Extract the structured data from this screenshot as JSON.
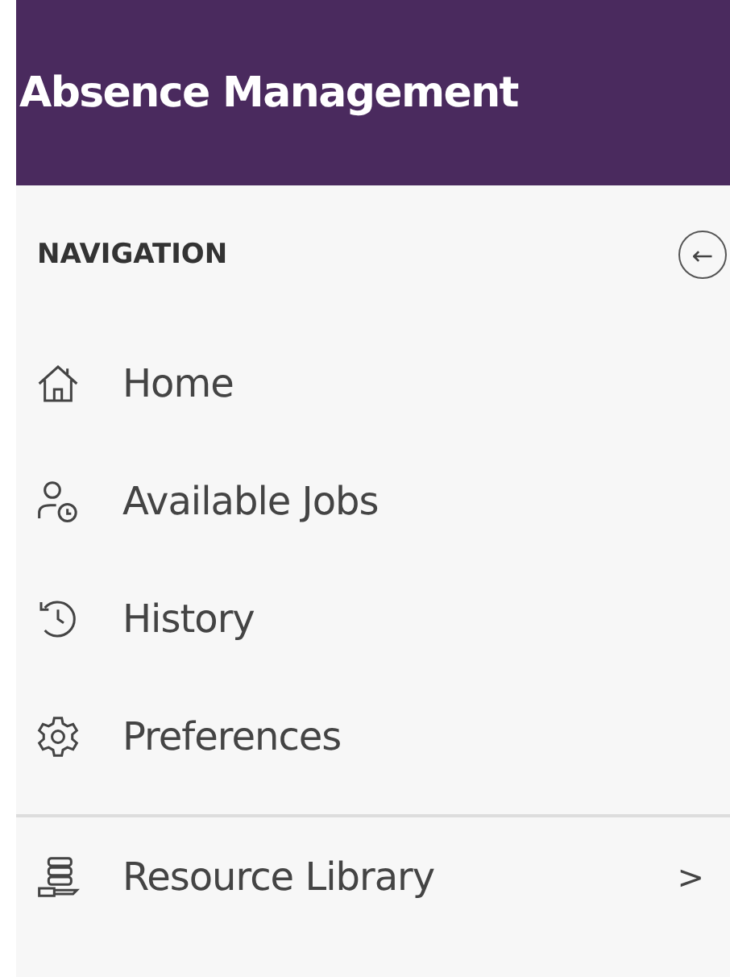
{
  "header": {
    "title": "Absence Management"
  },
  "navigation": {
    "heading": "NAVIGATION",
    "collapse_button": "←",
    "groups": [
      {
        "items": [
          {
            "label": "Home"
          },
          {
            "label": "Available Jobs"
          },
          {
            "label": "History"
          },
          {
            "label": "Preferences"
          }
        ]
      },
      {
        "items": [
          {
            "label": "Resource Library",
            "chevron": ">"
          }
        ]
      }
    ]
  }
}
